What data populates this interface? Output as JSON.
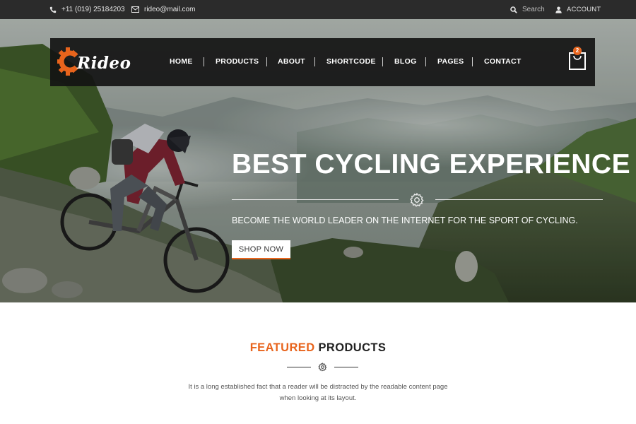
{
  "topbar": {
    "phone": "+11 (019) 25184203",
    "email": "rideo@mail.com",
    "search_placeholder": "Search",
    "account": "ACCOUNT"
  },
  "brand": {
    "logo_text": "Rideo",
    "accent_color": "#e8641c"
  },
  "nav": {
    "items": [
      "HOME",
      "PRODUCTS",
      "ABOUT",
      "SHORTCODE",
      "BLOG",
      "PAGES",
      "CONTACT"
    ],
    "cart_count": "2"
  },
  "hero": {
    "title": "BEST CYCLING EXPERIENCE",
    "subtitle": "BECOME THE WORLD LEADER ON THE INTERNET FOR THE SPORT OF CYCLING.",
    "button": "SHOP NOW"
  },
  "featured": {
    "title_accent": "FEATURED",
    "title_rest": "PRODUCTS",
    "description_line1": "It is a long established fact that a reader will be distracted by the readable content page",
    "description_line2": "when looking at its layout."
  },
  "icons": {
    "phone": "phone-icon",
    "email": "envelope-icon",
    "search": "search-icon",
    "account": "user-icon",
    "cart": "shopping-bag-icon",
    "divider": "gear-icon"
  }
}
